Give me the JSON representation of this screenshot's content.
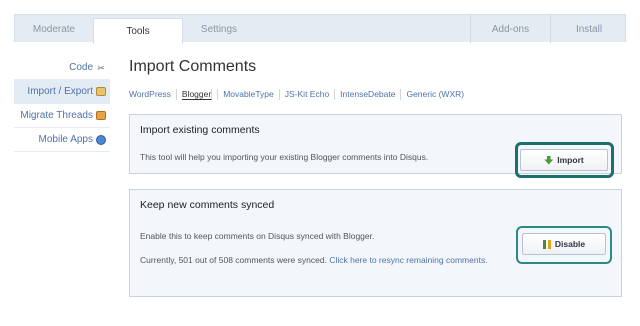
{
  "tabs": {
    "moderate": "Moderate",
    "tools": "Tools",
    "settings": "Settings",
    "addons": "Add-ons",
    "install": "Install"
  },
  "sidebar": {
    "items": [
      {
        "label": "Code",
        "icon": "code-icon"
      },
      {
        "label": "Import / Export",
        "icon": "import-export-icon"
      },
      {
        "label": "Migrate Threads",
        "icon": "migrate-icon"
      },
      {
        "label": "Mobile Apps",
        "icon": "mobile-globe-icon"
      }
    ]
  },
  "main": {
    "title": "Import Comments",
    "subnav": [
      "WordPress",
      "Blogger",
      "MovableType",
      "JS-Kit Echo",
      "IntenseDebate",
      "Generic (WXR)"
    ],
    "active_subnav": "Blogger"
  },
  "import_panel": {
    "title": "Import existing comments",
    "text": "This tool will help you importing your existing Blogger comments into Disqus.",
    "button": "Import"
  },
  "sync_panel": {
    "title": "Keep new comments synced",
    "text": "Enable this to keep comments on Disqus synced with Blogger.",
    "status_text": "Currently, 501 out of 508 comments were synced.",
    "resync_link": "Click here to resync remaining comments.",
    "button": "Disable"
  },
  "colors": {
    "accent_link": "#4f73a8",
    "panel_bg": "#f3f6fb",
    "annotation": "#1b6f6d"
  }
}
